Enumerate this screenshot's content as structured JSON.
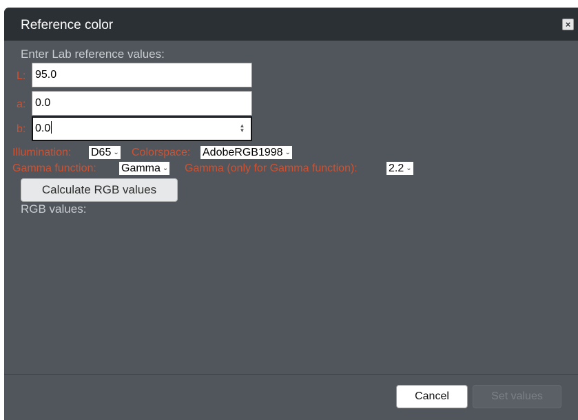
{
  "dialog": {
    "title": "Reference color",
    "close_icon": "close-icon"
  },
  "form": {
    "intro": "Enter Lab reference values:",
    "L": {
      "label": "L:",
      "value": "95.0"
    },
    "a": {
      "label": "a:",
      "value": "0.0"
    },
    "b": {
      "label": "b:",
      "value": "0.0"
    },
    "illumination": {
      "label": "Illumination:",
      "value": "D65"
    },
    "colorspace": {
      "label": "Colorspace:",
      "value": "AdobeRGB1998"
    },
    "gamma_function": {
      "label": "Gamma function:",
      "value": "Gamma"
    },
    "gamma_value": {
      "label": "Gamma (only for Gamma function):",
      "value": "2.2"
    },
    "calculate_label": "Calculate RGB values",
    "rgb_label": "RGB values:"
  },
  "footer": {
    "cancel_label": "Cancel",
    "set_label": "Set values"
  },
  "colors": {
    "titlebar": "#2b3035",
    "body": "#50565c",
    "label_accent": "#d2502f",
    "label_grey": "#c9ccd0"
  }
}
